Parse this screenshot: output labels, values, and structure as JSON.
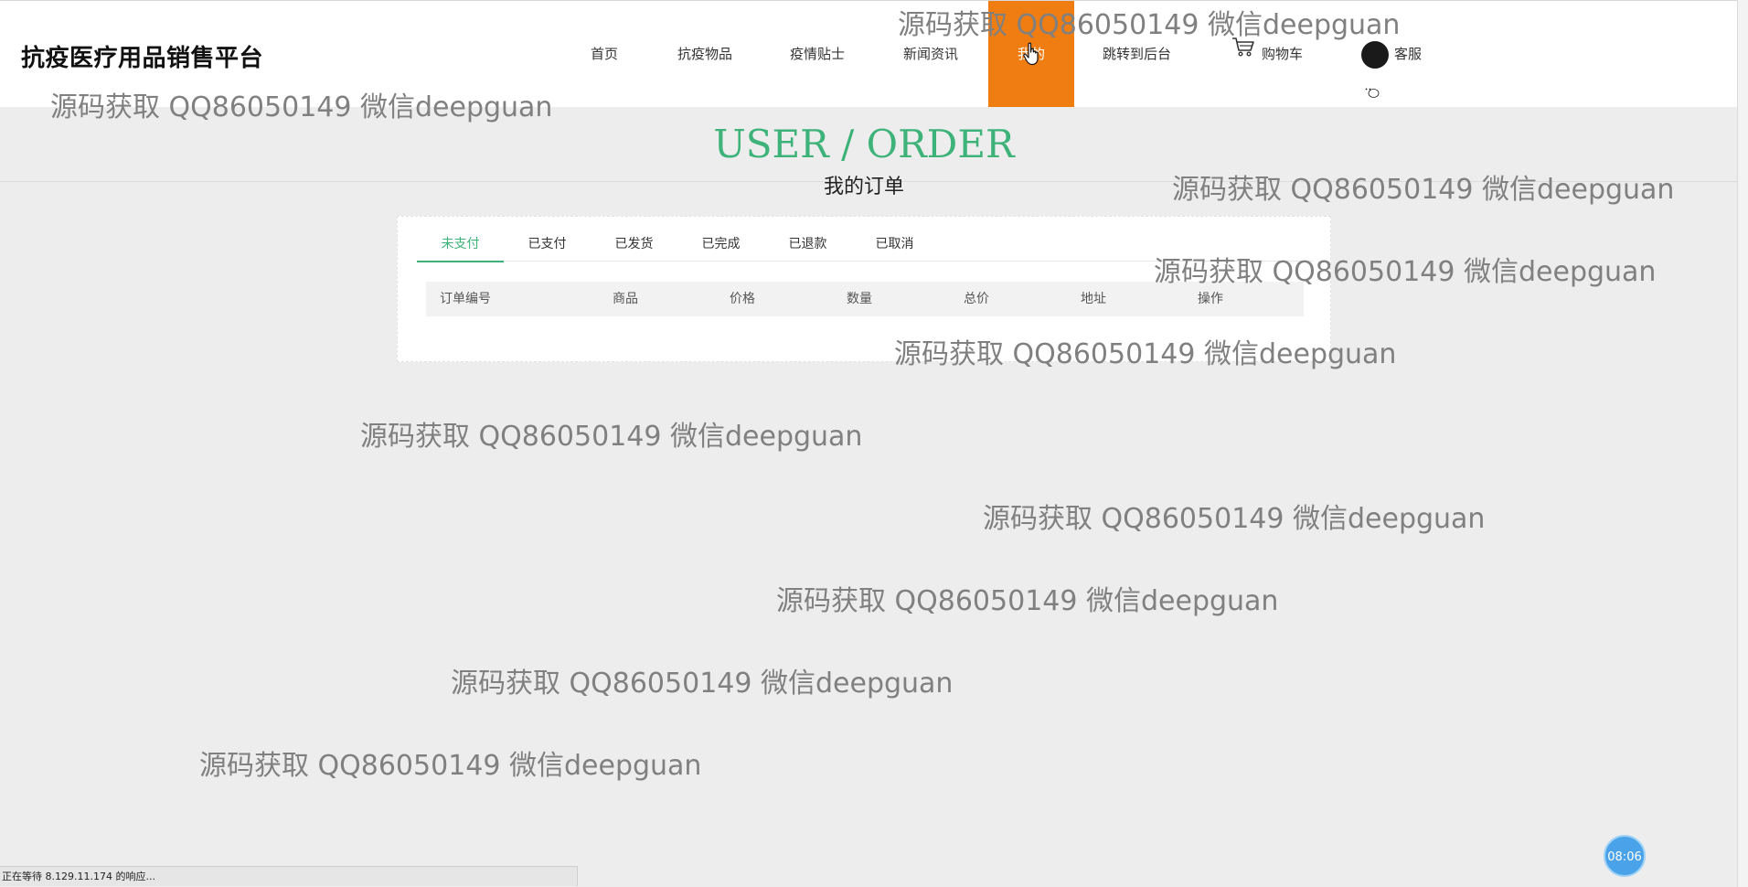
{
  "header": {
    "brand": "抗疫医疗用品销售平台",
    "nav": [
      {
        "label": "首页"
      },
      {
        "label": "抗疫物品"
      },
      {
        "label": "疫情贴士"
      },
      {
        "label": "新闻资讯"
      },
      {
        "label": "我的"
      },
      {
        "label": "跳转到后台"
      },
      {
        "label": "购物车",
        "icon": "cart-icon"
      },
      {
        "label": "客服",
        "icon": "wechat-icon"
      }
    ],
    "active_index": 4
  },
  "page": {
    "title_en": "USER / ORDER",
    "title_cn": "我的订单"
  },
  "orders": {
    "tabs": [
      "未支付",
      "已支付",
      "已发货",
      "已完成",
      "已退款",
      "已取消"
    ],
    "active_tab": 0,
    "columns": [
      "订单编号",
      "商品",
      "价格",
      "数量",
      "总价",
      "地址",
      "操作"
    ],
    "rows": []
  },
  "watermark": "源码获取 QQ86050149 微信deepguan",
  "status_bar": "正在等待 8.129.11.174 的响应...",
  "timer": "08:06",
  "colors": {
    "accent_green": "#3db37a",
    "nav_active": "#ef7d12",
    "background": "#ededed"
  }
}
